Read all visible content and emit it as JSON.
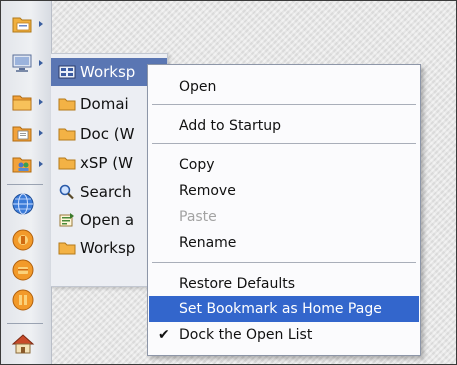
{
  "left_toolbar": {
    "items": [
      {
        "icon": "folder-arrow-icon"
      },
      {
        "icon": "monitor-arrow-icon"
      },
      {
        "icon": "folder-orange-icon"
      },
      {
        "icon": "folder-documents-icon"
      },
      {
        "icon": "folder-people-icon"
      },
      {
        "icon": "globe-icon"
      },
      {
        "icon": "orange-circle-icon"
      },
      {
        "icon": "orange-circle-icon"
      },
      {
        "icon": "orange-circle-icon"
      },
      {
        "icon": "home-icon"
      }
    ]
  },
  "open_list": {
    "items": [
      {
        "label": "Worksp",
        "icon": "workspace-icon",
        "selected": true
      },
      {
        "label": "Domai",
        "icon": "folder-icon"
      },
      {
        "label": "Doc (W",
        "icon": "folder-icon"
      },
      {
        "label": "xSP (W",
        "icon": "folder-icon"
      },
      {
        "label": "Search",
        "icon": "search-icon"
      },
      {
        "label": "Open a",
        "icon": "open-icon"
      },
      {
        "label": "Worksp",
        "icon": "folder-icon"
      }
    ]
  },
  "context_menu": {
    "items": [
      {
        "label": "Open"
      },
      {
        "label": "Add to Startup"
      },
      {
        "label": "Copy"
      },
      {
        "label": "Remove"
      },
      {
        "label": "Paste",
        "disabled": true
      },
      {
        "label": "Rename"
      },
      {
        "label": "Restore Defaults"
      },
      {
        "label": "Set Bookmark as Home Page",
        "highlighted": true
      },
      {
        "label": "Dock the Open List",
        "checked": true
      }
    ],
    "check_mark": "✔"
  },
  "colors": {
    "selection_blue": "#3366cc",
    "open_list_selected": "#5a76b3",
    "disabled_text": "#a3a3a3"
  }
}
